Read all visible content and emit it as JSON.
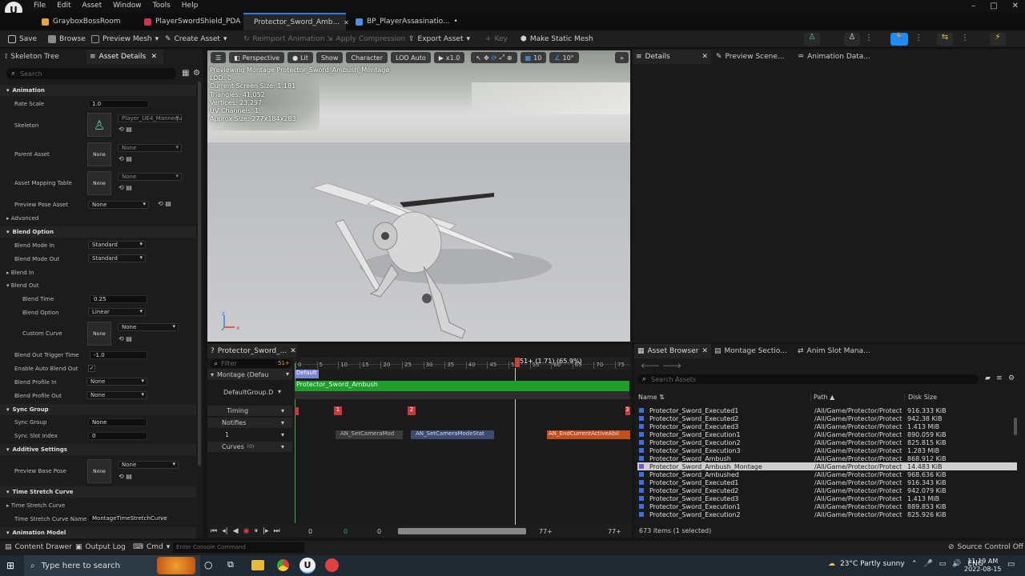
{
  "titlebar": {
    "menu": [
      "File",
      "Edit",
      "Asset",
      "Window",
      "Tools",
      "Help"
    ],
    "window_controls": [
      "minimize-icon",
      "maximize-icon",
      "close-icon"
    ]
  },
  "tabs": [
    {
      "label": "GrayboxBossRoom",
      "icon_color": "#e8a33d"
    },
    {
      "label": "PlayerSwordShield_PDA",
      "icon_color": "#d0344a"
    },
    {
      "label": "Protector_Sword_Amb...",
      "icon_color": "#3b82f6",
      "active": true
    },
    {
      "label": "BP_PlayerAssasinatio...",
      "icon_color": "#4e8fe0",
      "dirty": "•"
    }
  ],
  "toolbar": {
    "save": "Save",
    "browse": "Browse",
    "preview_mesh": "Preview Mesh",
    "create_asset": "Create Asset",
    "reimport": "Reimport Animation",
    "apply_compression": "Apply Compression",
    "export_asset": "Export Asset",
    "key": "Key",
    "make_static_mesh": "Make Static Mesh"
  },
  "left": {
    "tabs": [
      "Skeleton Tree",
      "Asset Details"
    ],
    "search_placeholder": "Search",
    "animation": {
      "header": "Animation",
      "rate_scale_label": "Rate Scale",
      "rate_scale": "1.0",
      "skeleton_label": "Skeleton",
      "skeleton_value": "Player_UE4_Mannequ",
      "parent_asset_label": "Parent Asset",
      "none": "None",
      "asset_mapping_label": "Asset Mapping Table",
      "preview_pose_label": "Preview Pose Asset",
      "advanced": "Advanced"
    },
    "blend": {
      "header": "Blend Option",
      "blend_mode_in_label": "Blend Mode In",
      "blend_mode_in": "Standard",
      "blend_mode_out_label": "Blend Mode Out",
      "blend_mode_out": "Standard",
      "blend_in": "Blend In",
      "blend_out": "Blend Out",
      "blend_time_label": "Blend Time",
      "blend_time": "0.25",
      "blend_option_label": "Blend Option",
      "blend_option": "Linear",
      "custom_curve_label": "Custom Curve",
      "trigger_label": "Blend Out Trigger Time",
      "trigger": "-1.0",
      "auto_blend_label": "Enable Auto Blend Out",
      "profile_in_label": "Blend Profile In",
      "profile_out_label": "Blend Profile Out"
    },
    "sync": {
      "header": "Sync Group",
      "sync_group_label": "Sync Group",
      "sync_group": "None",
      "slot_index_label": "Sync Slot Index",
      "slot_index": "0"
    },
    "additive": {
      "header": "Additive Settings",
      "base_pose_label": "Preview Base Pose"
    },
    "stretch": {
      "header": "Time Stretch Curve",
      "curve_label": "Time Stretch Curve",
      "curve_name_label": "Time Stretch Curve Name",
      "curve_name": "MontageTimeStretchCurve"
    },
    "model_header": "Animation Model"
  },
  "viewport": {
    "buttons": [
      "Perspective",
      "Lit",
      "Show",
      "Character",
      "LOD Auto",
      "x1.0"
    ],
    "grid": "10",
    "angle": "10°",
    "info": [
      "Previewing Montage Protector_Sword_Ambush_Montage",
      "LOD: 0",
      "Current Screen Size: 1.181",
      "Triangles: 41,052",
      "Vertices: 23,297",
      "UV Channels: 1",
      "Approx Size: 277x184x283"
    ]
  },
  "right_tabs": [
    "Details",
    "Preview Scene...",
    "Animation Data..."
  ],
  "timeline": {
    "tab": "Protector_Sword_...",
    "filter_placeholder": "Filter",
    "frame_count": "51+",
    "playhead": "51+ (1.71) (65.9%)",
    "ticks": [
      "0",
      "5",
      "10",
      "15",
      "20",
      "25",
      "30",
      "35",
      "40",
      "45",
      "50",
      "55",
      "60",
      "65",
      "70",
      "75"
    ],
    "montage_label": "Montage (Defau",
    "default_section": "Default",
    "default_group": "DefaultGroup.D",
    "segment": "Protector_Sword_Ambush",
    "timing": "Timing",
    "timing_markers": [
      "1",
      "2",
      "3"
    ],
    "notifies": "Notifies",
    "notify_track": "1",
    "notify_items": [
      "AN_SetCameraMod",
      "AN_SetCameraModeStat",
      "AN_EndCurrentActiveAbil"
    ],
    "curves": "Curves",
    "curves_count": "(0)",
    "transport": {
      "start": "0",
      "a": "0",
      "b": "0",
      "end1": "77+",
      "end2": "77+"
    }
  },
  "asset_browser": {
    "tabs": [
      "Asset Browser",
      "Montage Sectio...",
      "Anim Slot Mana..."
    ],
    "search_placeholder": "Search Assets",
    "columns": [
      "Name",
      "Path",
      "Disk Size"
    ],
    "rows": [
      {
        "name": "Protector_Sword_Executed1",
        "path": "/All/Game/Protector/Protect",
        "size": "916.333 KiB"
      },
      {
        "name": "Protector_Sword_Executed2",
        "path": "/All/Game/Protector/Protect",
        "size": "942.38 KiB"
      },
      {
        "name": "Protector_Sword_Executed3",
        "path": "/All/Game/Protector/Protect",
        "size": "1.413 MiB"
      },
      {
        "name": "Protector_Sword_Execution1",
        "path": "/All/Game/Protector/Protect",
        "size": "890.059 KiB"
      },
      {
        "name": "Protector_Sword_Execution2",
        "path": "/All/Game/Protector/Protect",
        "size": "825.815 KiB"
      },
      {
        "name": "Protector_Sword_Execution3",
        "path": "/All/Game/Protector/Protect",
        "size": "1.283 MiB"
      },
      {
        "name": "Protector_Sword_Ambush",
        "path": "/All/Game/Protector/Protect",
        "size": "868.912 KiB"
      },
      {
        "name": "Protector_Sword_Ambush_Montage",
        "path": "/All/Game/Protector/Protect",
        "size": "14.483 KiB",
        "selected": true
      },
      {
        "name": "Protector_Sword_Ambushed",
        "path": "/All/Game/Protector/Protect",
        "size": "968.636 KiB"
      },
      {
        "name": "Protector_Sword_Executed1",
        "path": "/All/Game/Protector/Protect",
        "size": "916.343 KiB"
      },
      {
        "name": "Protector_Sword_Executed2",
        "path": "/All/Game/Protector/Protect",
        "size": "942.079 KiB"
      },
      {
        "name": "Protector_Sword_Executed3",
        "path": "/All/Game/Protector/Protect",
        "size": "1.413 MiB"
      },
      {
        "name": "Protector_Sword_Execution1",
        "path": "/All/Game/Protector/Protect",
        "size": "889.853 KiB"
      },
      {
        "name": "Protector_Sword_Execution2",
        "path": "/All/Game/Protector/Protect",
        "size": "825.926 KiB"
      }
    ],
    "count": "673 items (1 selected)"
  },
  "bottombar": {
    "content_drawer": "Content Drawer",
    "output_log": "Output Log",
    "cmd": "Cmd",
    "console_placeholder": "Enter Console Command",
    "source_control": "Source Control Off"
  },
  "taskbar": {
    "search_placeholder": "Type here to search",
    "weather": "23°C  Partly sunny",
    "lang": "ENG",
    "time": "11:19 AM",
    "date": "2022-08-15"
  }
}
